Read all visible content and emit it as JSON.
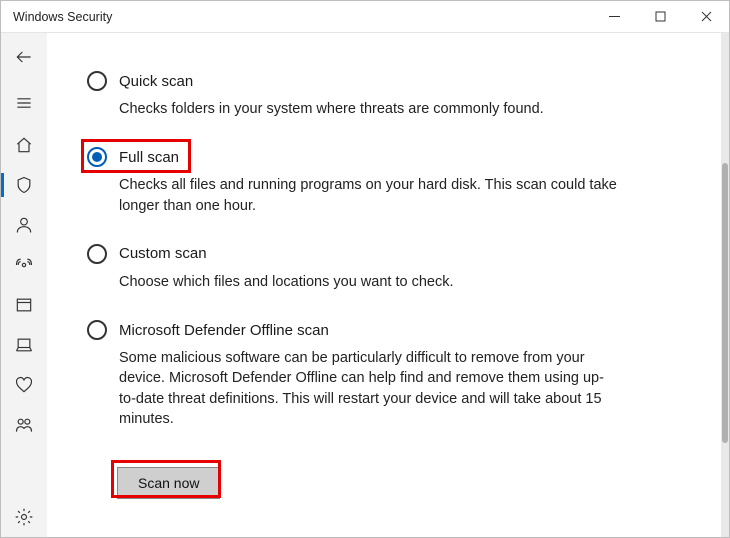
{
  "window": {
    "title": "Windows Security"
  },
  "options": {
    "quick": {
      "label": "Quick scan",
      "desc": "Checks folders in your system where threats are commonly found."
    },
    "full": {
      "label": "Full scan",
      "desc": "Checks all files and running programs on your hard disk. This scan could take longer than one hour."
    },
    "custom": {
      "label": "Custom scan",
      "desc": "Choose which files and locations you want to check."
    },
    "offline": {
      "label": "Microsoft Defender Offline scan",
      "desc": "Some malicious software can be particularly difficult to remove from your device. Microsoft Defender Offline can help find and remove them using up-to-date threat definitions. This will restart your device and will take about 15 minutes."
    }
  },
  "selected": "full",
  "actions": {
    "scan_now": "Scan now"
  }
}
